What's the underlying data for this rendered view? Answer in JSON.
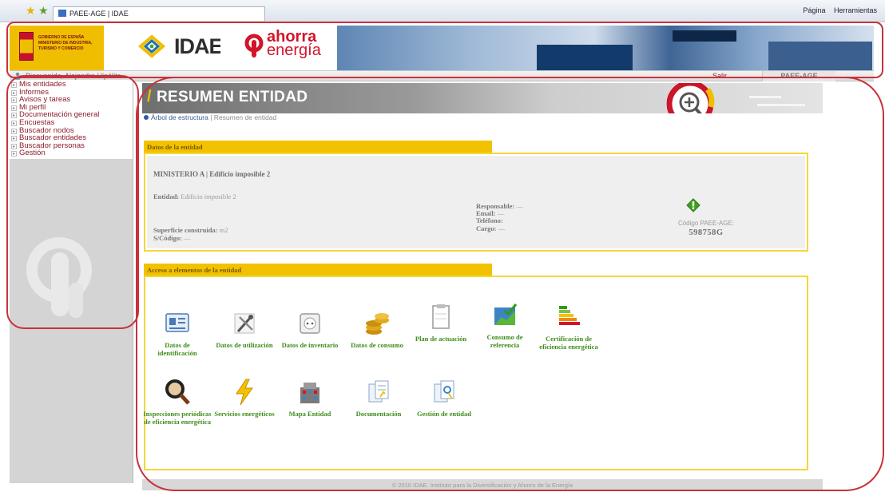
{
  "browser": {
    "tab_title": "PAEE-AGE | IDAE",
    "tools": [
      "Página",
      "Herramientas"
    ]
  },
  "header": {
    "gov_text": "GOBIERNO DE ESPAÑA MINISTERIO DE INDUSTRIA, TURISMO Y COMERCIO",
    "idae_logo": "IDAE",
    "ahorra_line1": "ahorra",
    "ahorra_line2": "energía"
  },
  "welcome_bar": {
    "text": "Bienvenido, Alejandro Hipólito",
    "logout": "Salir",
    "app_name": "PAEE-AGE"
  },
  "sidebar": {
    "items": [
      "Mis entidades",
      "Informes",
      "Avisos y tareas",
      "Mi perfil",
      "Documentación general",
      "Encuestas",
      "Buscador nodos",
      "Buscador entidades",
      "Buscador personas",
      "Gestión"
    ]
  },
  "page": {
    "title": "RESUMEN ENTIDAD",
    "breadcrumb_link": "Árbol de estructura",
    "breadcrumb_current": "Resumen de entidad"
  },
  "datos": {
    "section_label": "Datos de la entidad",
    "entity_name": "MINISTERIO A | Edificio imposible 2",
    "entidad_label": "Entidad:",
    "entidad_value": "Edificio imposible 2",
    "superficie_label": "Superficie construida:",
    "superficie_value": "m2",
    "scodigo_label": "S/Código:",
    "scodigo_value": "—",
    "responsable_label": "Responsable:",
    "responsable_value": "—",
    "email_label": "Email:",
    "email_value": "—",
    "telefono_label": "Teléfono:",
    "cargo_label": "Cargo:",
    "cargo_value": "—",
    "codigo_label": "Código PAEE-AGE:",
    "codigo_value": "598758G"
  },
  "acceso": {
    "section_label": "Acceso a elementos de la entidad",
    "tiles": [
      {
        "label": "Datos de identificación",
        "icon": "id-card-icon"
      },
      {
        "label": "Datos de utilización",
        "icon": "tools-icon"
      },
      {
        "label": "Datos de inventario",
        "icon": "socket-icon"
      },
      {
        "label": "Datos de consumo",
        "icon": "coins-icon"
      },
      {
        "label": "Plan de actuación",
        "icon": "clipboard-icon"
      },
      {
        "label": "Consumo de referencia",
        "icon": "chart-check-icon"
      },
      {
        "label": "Certificación de eficiencia energética",
        "icon": "energy-rating-icon"
      },
      {
        "label": "Inspecciones periódicas de eficiencia energética",
        "icon": "magnifier-icon"
      },
      {
        "label": "Servicios energéticos",
        "icon": "lightning-icon"
      },
      {
        "label": "Mapa Entidad",
        "icon": "building-icon"
      },
      {
        "label": "Documentación",
        "icon": "documents-icon"
      },
      {
        "label": "Gestión de entidad",
        "icon": "management-icon"
      }
    ]
  },
  "footer": {
    "text": "© 2010 IDAE. Instituto para la Diversificación y Ahorro de la Energía"
  },
  "colors": {
    "accent_yellow": "#f2c200",
    "menu_red": "#8b1c2a",
    "tile_green": "#3e8e1a",
    "annotation_red": "#c8323c"
  }
}
